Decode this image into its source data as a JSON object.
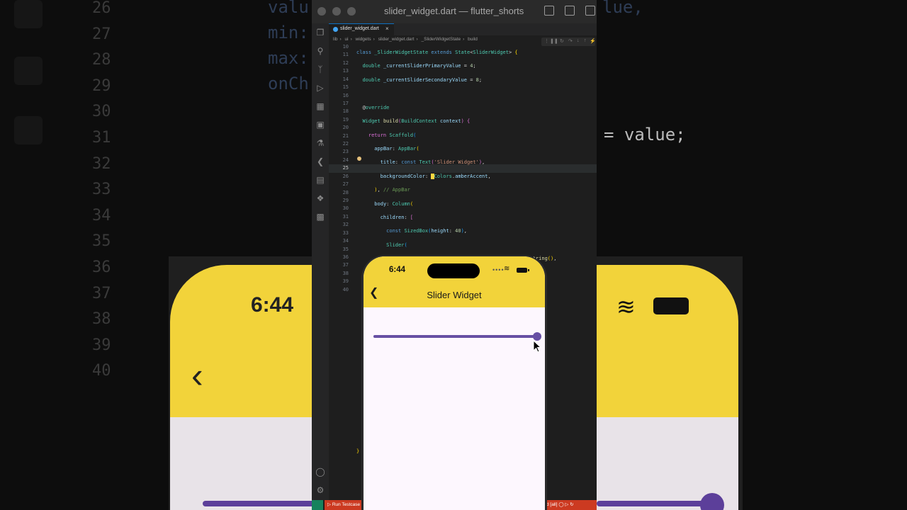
{
  "window": {
    "title": "slider_widget.dart — flutter_shorts"
  },
  "tab": {
    "label": "slider_widget.dart",
    "close": "×"
  },
  "breadcrumb": [
    "lib",
    "ui",
    "widgets",
    "slider_widget.dart",
    "_SliderWidgetState",
    "build"
  ],
  "editor": {
    "line_numbers": [
      "10",
      "11",
      "12",
      "13",
      "14",
      "15",
      "16",
      "17",
      "18",
      "19",
      "20",
      "21",
      "22",
      "23",
      "24",
      "25",
      "26",
      "27",
      "28",
      "29",
      "30",
      "31",
      "32",
      "33",
      "34",
      "35",
      "36",
      "37",
      "38",
      "39",
      "40"
    ]
  },
  "statusbar": {
    "run_label": "Run Testcase",
    "right_label": "d  [all]"
  },
  "phone": {
    "time": "6:44",
    "back_icon": "chevron-left-icon",
    "title": "Slider Widget",
    "appbar_color": "#f2d33a",
    "accent_color": "#6750a4",
    "slider": {
      "min": 0,
      "max": 10,
      "value": 10
    }
  },
  "background": {
    "line_numbers": [
      "26",
      "27",
      "28",
      "29",
      "30",
      "31",
      "32",
      "33",
      "34",
      "35",
      "36",
      "37",
      "38",
      "39",
      "40"
    ],
    "time": "6:44"
  }
}
